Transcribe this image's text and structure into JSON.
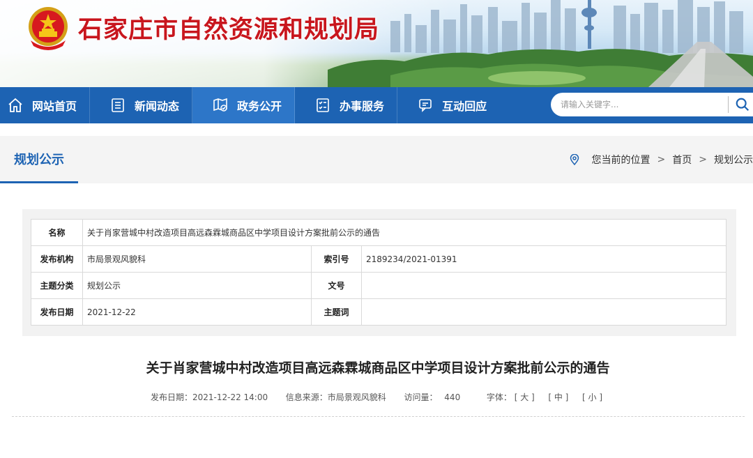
{
  "header": {
    "site_title": "石家庄市自然资源和规划局"
  },
  "nav": {
    "items": [
      {
        "label": "网站首页",
        "icon": "home-icon"
      },
      {
        "label": "新闻动态",
        "icon": "news-icon"
      },
      {
        "label": "政务公开",
        "icon": "gov-affairs-icon"
      },
      {
        "label": "办事服务",
        "icon": "service-icon"
      },
      {
        "label": "互动回应",
        "icon": "chat-icon"
      }
    ],
    "search_placeholder": "请输入关键字..."
  },
  "subheader": {
    "section_title": "规划公示",
    "breadcrumb_label": "您当前的位置",
    "crumbs": [
      "首页",
      "规划公示"
    ]
  },
  "info_table": {
    "name_key": "名称",
    "name_value": "关于肖家营城中村改造项目高远森霖城商品区中学项目设计方案批前公示的通告",
    "publisher_key": "发布机构",
    "publisher_value": "市局景观风貌科",
    "index_key": "索引号",
    "index_value": "2189234/2021-01391",
    "category_key": "主题分类",
    "category_value": "规划公示",
    "docno_key": "文号",
    "docno_value": "",
    "date_key": "发布日期",
    "date_value": "2021-12-22",
    "keywords_key": "主题词",
    "keywords_value": ""
  },
  "article": {
    "title": "关于肖家营城中村改造项目高远森霖城商品区中学项目设计方案批前公示的通告",
    "meta_date": "发布日期：2021-12-22 14:00",
    "meta_source": "信息来源：市局景观风貌科",
    "meta_views_label": "访问量：",
    "meta_views": "440",
    "meta_font_label": "字体：",
    "font_large": "[ 大 ]",
    "font_medium": "[ 中 ]",
    "font_small": "[ 小 ]"
  },
  "colors": {
    "nav_bg": "#1d63b3",
    "nav_active": "#2d76c8",
    "title_red": "#c8161d",
    "accent_blue": "#1d63b3"
  }
}
